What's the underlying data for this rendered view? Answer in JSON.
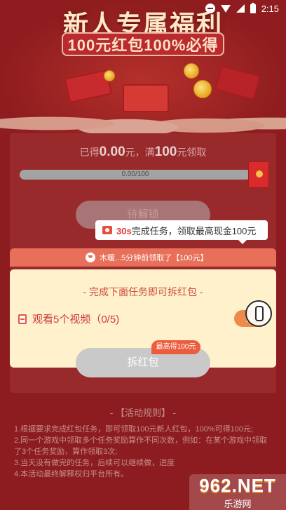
{
  "status_bar": {
    "time": "2:15"
  },
  "banner": {
    "title": "新人专属福利",
    "subtitle": "100元红包100%必得"
  },
  "progress": {
    "earned_prefix": "已得",
    "earned_amount": "0.00",
    "earned_unit": "元，满",
    "target_amount": "100",
    "target_suffix": "元领取",
    "bar_text": "0.00/100",
    "fraction": 0
  },
  "unlock_button": {
    "label": "待解锁"
  },
  "tooltip": {
    "time": "30s",
    "text": "完成任务，领取最高现金100元"
  },
  "notice": {
    "text": "木暖...5分钟前领取了【100元】"
  },
  "task_panel": {
    "header": "- 完成下面任务即可拆红包 -",
    "tasks": [
      {
        "label": "观看5个视频（0/5)",
        "button": "去"
      }
    ],
    "max_badge": "最高得100元",
    "open_button": "拆红包"
  },
  "rules": {
    "title": "- 【活动规则】 -",
    "lines": [
      "1.根据要求完成红包任务，即可领取100元新人红包，100%可得100元;",
      "2.同一个游戏中领取多个任务奖励算作不同次数，例如：在某个游戏中领取了3个任务奖励，算作领取3次;",
      "3.当天没有做完的任务，后续可以继续做，进度",
      "4.本活动最终解释权归平台所有。"
    ]
  },
  "watermark": {
    "logo": "962.NET",
    "sub": "乐游网"
  },
  "colors": {
    "background": "#8c1c1f",
    "accent": "#e4393c",
    "task_panel": "#fff1cc",
    "notice": "#e8705a"
  }
}
